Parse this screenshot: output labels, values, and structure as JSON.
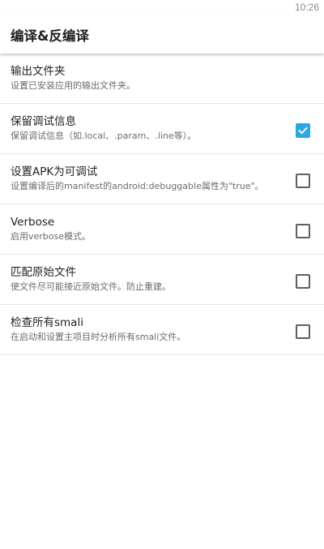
{
  "status_bar": {
    "time": "10:26"
  },
  "app_bar": {
    "title": "编译&反编译"
  },
  "settings": [
    {
      "title": "输出文件夹",
      "summary": "设置已安装应用的输出文件夹。",
      "has_checkbox": false
    },
    {
      "title": "保留调试信息",
      "summary": "保留调试信息（如.local、.param、.line等）。",
      "has_checkbox": true,
      "checked": true
    },
    {
      "title": "设置APK为可调试",
      "summary": "设置编译后的manifest的android:debuggable属性为\"true\"。",
      "has_checkbox": true,
      "checked": false
    },
    {
      "title": "Verbose",
      "summary": "启用verbose模式。",
      "has_checkbox": true,
      "checked": false
    },
    {
      "title": "匹配原始文件",
      "summary": "使文件尽可能接近原始文件。防止重建。",
      "has_checkbox": true,
      "checked": false
    },
    {
      "title": "检查所有smali",
      "summary": "在启动和设置主项目时分析所有smali文件。",
      "has_checkbox": true,
      "checked": false
    }
  ],
  "colors": {
    "accent": "#29a9e0",
    "checkbox_border": "#5f5f5f",
    "divider": "#e6e6e6"
  },
  "icons": {
    "checkmark": "check-icon"
  }
}
